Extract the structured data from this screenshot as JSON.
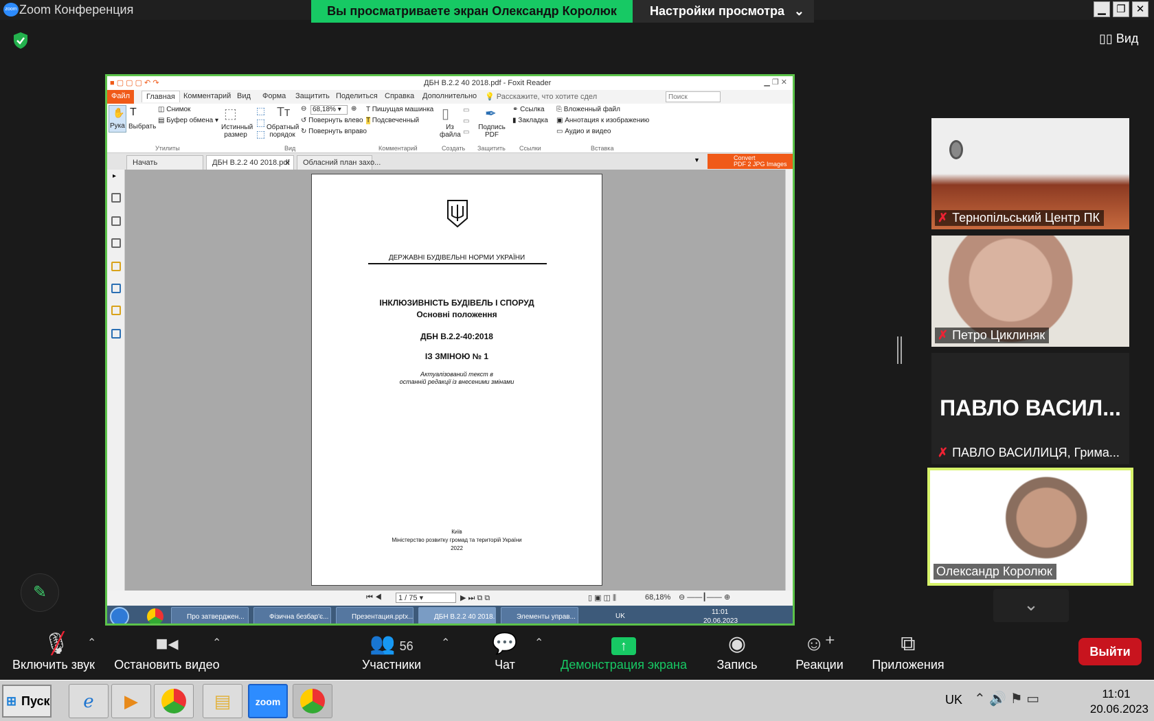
{
  "window": {
    "title": "Zoom Конференция",
    "logo_text": "zoom"
  },
  "share_banner": {
    "text": "Вы просматриваете экран Олександр Королюк",
    "view_settings": "Настройки просмотра"
  },
  "top": {
    "view_label": "Вид"
  },
  "foxit": {
    "title": "ДБН В.2.2 40 2018.pdf - Foxit Reader",
    "menu": [
      "Файл",
      "Главная",
      "Комментарий",
      "Вид",
      "Форма",
      "Защитить",
      "Поделиться",
      "Справка",
      "Дополнительно",
      "Расскажите, что хотите сдел"
    ],
    "search_placeholder": "Поиск",
    "ribbon": {
      "hand": "Рука",
      "select": "Выбрать",
      "snapshot": "Снимок",
      "clipboard": "Буфер обмена",
      "actual_size": "Истинный размер",
      "reverse_order": "Обратный порядок",
      "zoom_value": "68,18%",
      "rotate_left": "Повернуть влево",
      "rotate_right": "Повернуть вправо",
      "typewriter": "Пишущая машинка",
      "highlight": "Подсвеченный",
      "from_file": "Из файла",
      "sign_pdf": "Подпись PDF",
      "link": "Ссылка",
      "bookmark": "Закладка",
      "attached_file": "Вложенный файл",
      "image_annotation": "Аннотация к изображению",
      "audio_video": "Аудио и видео",
      "groups": [
        "Утилиты",
        "Вид",
        "Комментарий",
        "Создать",
        "Защитить",
        "Ссылки",
        "Вставка"
      ]
    },
    "tabs": [
      "Начать",
      "ДБН В.2.2 40 2018.pdf",
      "Обласний план захо..."
    ],
    "convert_ad": [
      "Convert",
      "PDF 2 JPG Images"
    ],
    "page": {
      "header": "ДЕРЖАВНІ БУДІВЕЛЬНІ НОРМИ УКРАЇНИ",
      "title": "ІНКЛЮЗИВНІСТЬ БУДІВЕЛЬ І СПОРУД",
      "subtitle": "Основні положення",
      "code": "ДБН В.2.2-40:2018",
      "amendment": "ІЗ ЗМІНОЮ № 1",
      "note1": "Актуалізований текст в",
      "note2": "останній редакції із внесеними змінами",
      "city": "Київ",
      "ministry": "Міністерство  розвитку громад та територій  України",
      "year": "2022"
    },
    "status": {
      "page": "1 / 75",
      "zoom": "68,18%"
    },
    "taskbar": {
      "items": [
        "Про затверджен...",
        "Фізична безбар'є...",
        "Презентация.pptx...",
        "ДБН В.2.2 40 2018...",
        "Элементы управ..."
      ],
      "lang": "UK",
      "time": "11:01",
      "date": "20.06.2023"
    }
  },
  "participants": [
    {
      "name": "Тернопільський Центр ПК",
      "muted": true
    },
    {
      "name": "Петро Циклиняк",
      "muted": true
    },
    {
      "name": "ПАВЛО ВАСИЛИЦЯ, Грима...",
      "big_name": "ПАВЛО  ВАСИЛ...",
      "muted": true
    },
    {
      "name": "Олександр Королюк",
      "muted": false,
      "active": true
    }
  ],
  "toolbar": {
    "audio": "Включить звук",
    "video": "Остановить видео",
    "participants": "Участники",
    "participants_count": "56",
    "chat": "Чат",
    "share": "Демонстрация экрана",
    "record": "Запись",
    "reactions": "Реакции",
    "apps": "Приложения",
    "leave": "Выйти"
  },
  "xp_taskbar": {
    "start": "Пуск",
    "lang": "UK",
    "time": "11:01",
    "date": "20.06.2023"
  },
  "colors": {
    "zoom_green": "#17c964",
    "leave_red": "#c8141e",
    "foxit_orange": "#f05a18",
    "active_speaker": "#d7f36a"
  }
}
